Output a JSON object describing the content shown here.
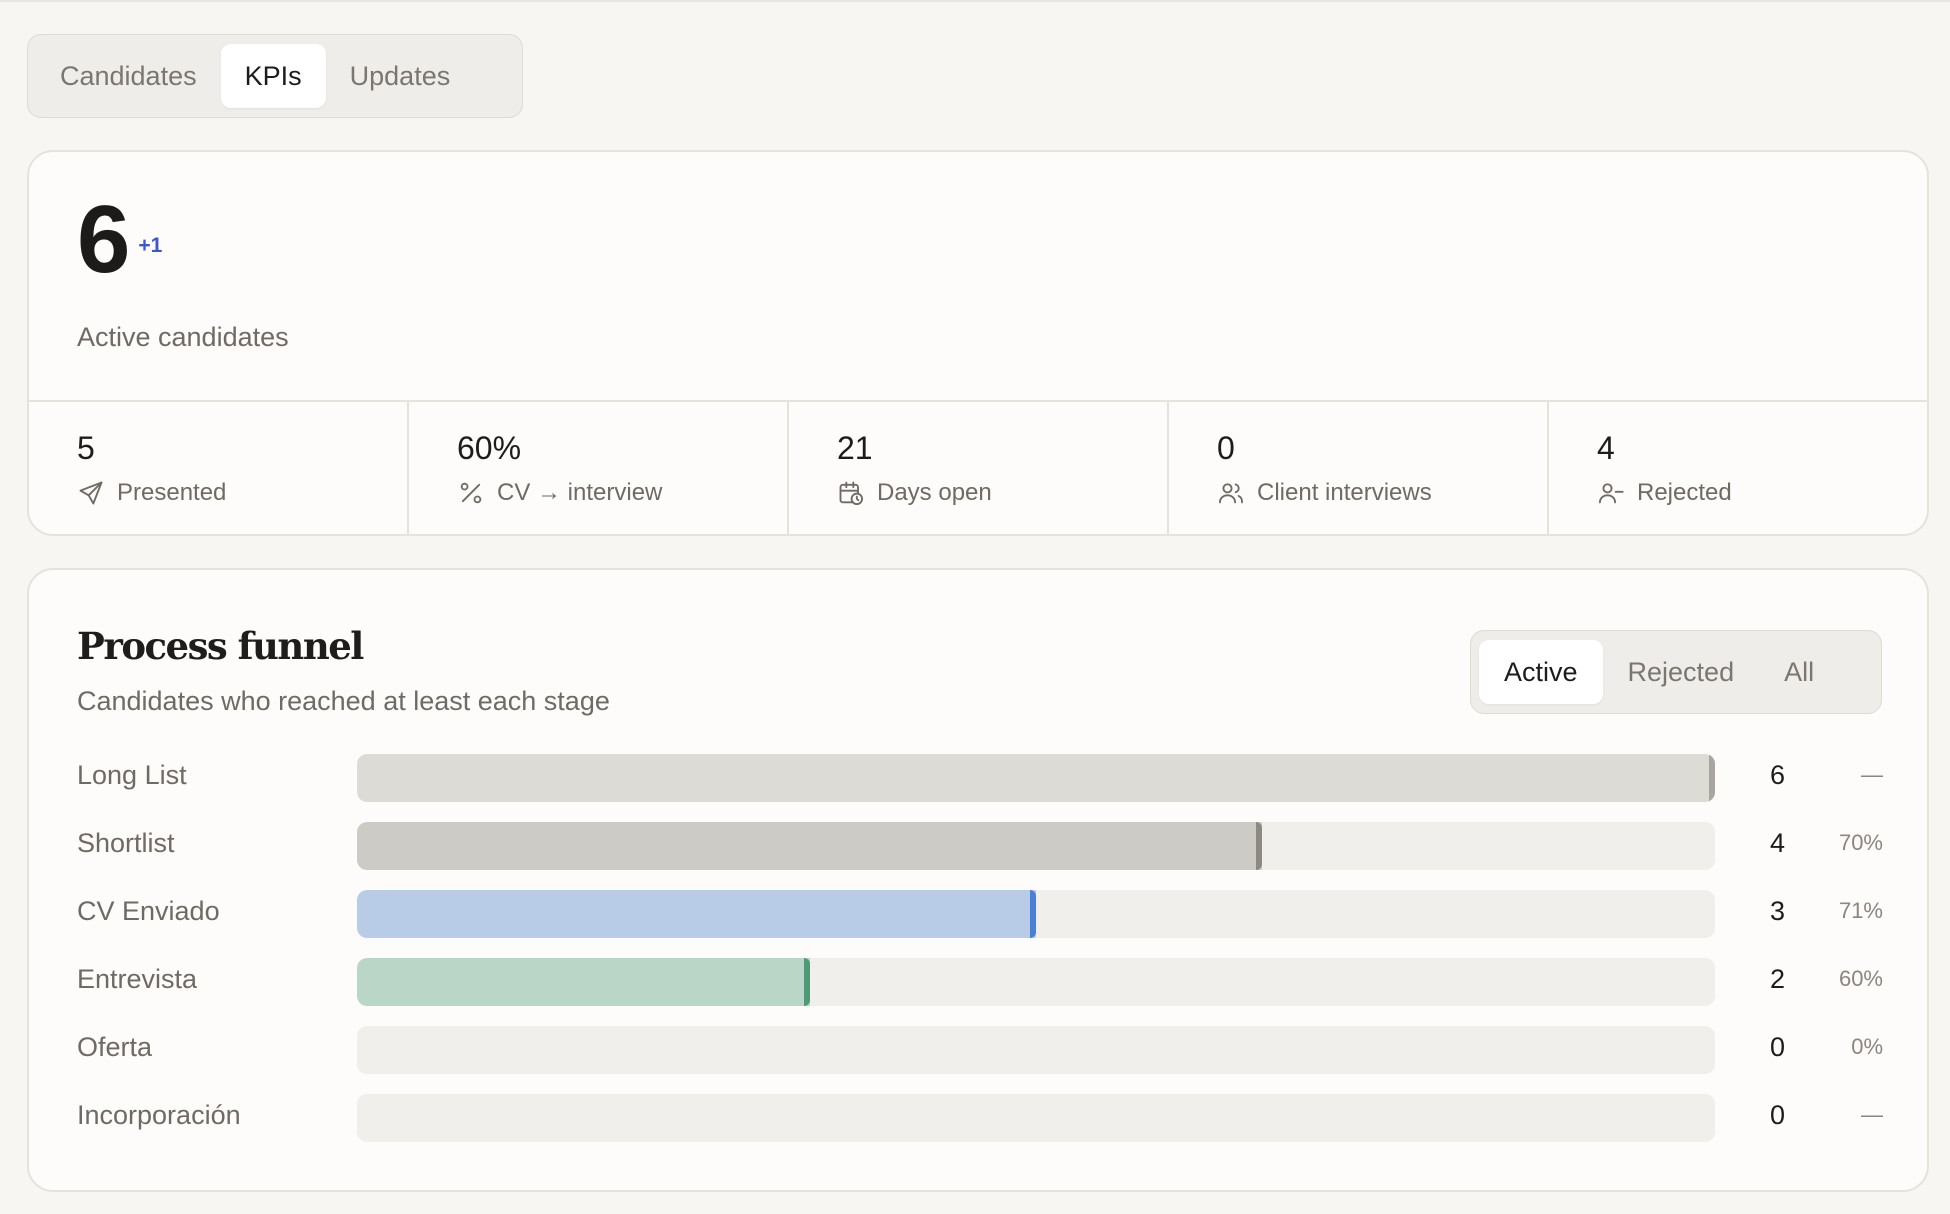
{
  "tabs": [
    {
      "label": "Candidates",
      "active": false
    },
    {
      "label": "KPIs",
      "active": true
    },
    {
      "label": "Updates",
      "active": false
    }
  ],
  "kpis": {
    "active_count": "6",
    "active_delta": "+1",
    "active_label": "Active candidates",
    "stats": [
      {
        "value": "5",
        "label": "Presented",
        "icon": "send-icon"
      },
      {
        "value": "60%",
        "label": "CV → interview",
        "icon": "percent-icon"
      },
      {
        "value": "21",
        "label": "Days open",
        "icon": "calendar-clock-icon"
      },
      {
        "value": "0",
        "label": "Client interviews",
        "icon": "users-icon"
      },
      {
        "value": "4",
        "label": "Rejected",
        "icon": "user-minus-icon"
      }
    ]
  },
  "funnel": {
    "title": "Process funnel",
    "subtitle": "Candidates who reached at least each stage",
    "filters": [
      {
        "label": "Active",
        "active": true
      },
      {
        "label": "Rejected",
        "active": false
      },
      {
        "label": "All",
        "active": false
      }
    ],
    "max": 6,
    "stages": [
      {
        "name": "Long List",
        "count": "6",
        "value": 6,
        "pct": "—",
        "color": "#dddbd6",
        "edge": "#a9a6a0"
      },
      {
        "name": "Shortlist",
        "count": "4",
        "value": 4,
        "pct": "70%",
        "color": "#cdcbc6",
        "edge": "#8d8983"
      },
      {
        "name": "CV Enviado",
        "count": "3",
        "value": 3,
        "pct": "71%",
        "color": "#b8cce8",
        "edge": "#4a7fd6"
      },
      {
        "name": "Entrevista",
        "count": "2",
        "value": 2,
        "pct": "60%",
        "color": "#b9d6c6",
        "edge": "#4f9a74"
      },
      {
        "name": "Oferta",
        "count": "0",
        "value": 0,
        "pct": "0%",
        "color": "#dddbd6",
        "edge": "#a9a6a0"
      },
      {
        "name": "Incorporación",
        "count": "0",
        "value": 0,
        "pct": "—",
        "color": "#dddbd6",
        "edge": "#a9a6a0"
      }
    ]
  }
}
